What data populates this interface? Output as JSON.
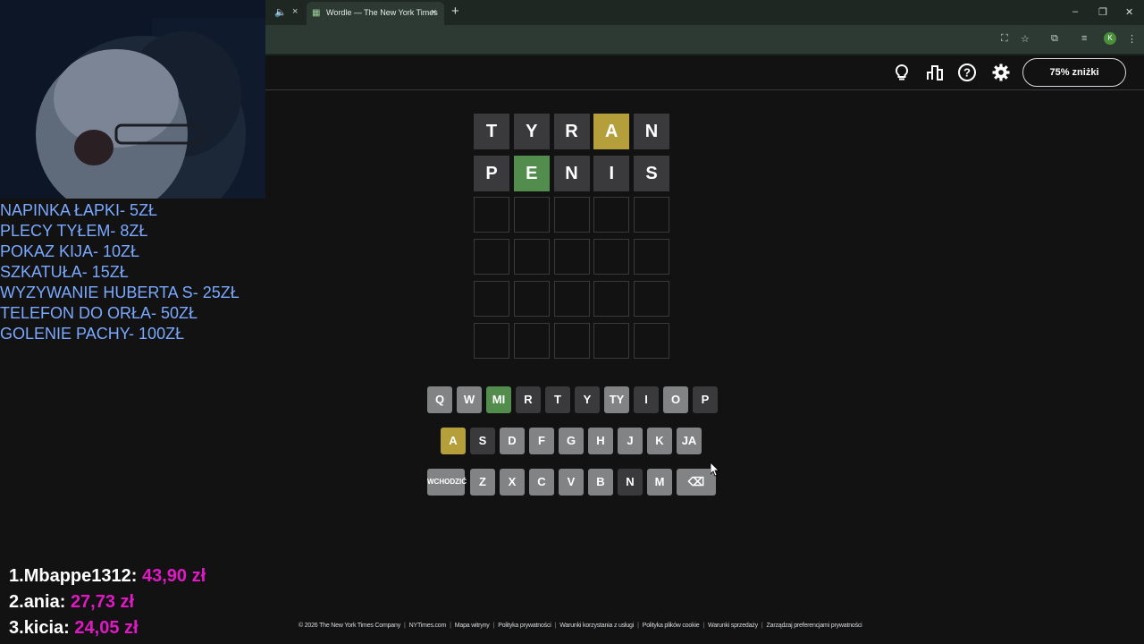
{
  "browser": {
    "prev_tab_close": "×",
    "active_tab_title": "Wordle — The New York Times",
    "tab_close": "×",
    "new_tab": "+",
    "profile_initial": "K",
    "win_minimize": "–",
    "win_restore": "❐",
    "win_close": "✕"
  },
  "header": {
    "subscribe_label": "75% zniżki"
  },
  "board": {
    "rows": [
      [
        {
          "letter": "T",
          "state": "absent"
        },
        {
          "letter": "Y",
          "state": "absent"
        },
        {
          "letter": "R",
          "state": "absent"
        },
        {
          "letter": "A",
          "state": "present"
        },
        {
          "letter": "N",
          "state": "absent"
        }
      ],
      [
        {
          "letter": "P",
          "state": "absent"
        },
        {
          "letter": "E",
          "state": "correct"
        },
        {
          "letter": "N",
          "state": "absent"
        },
        {
          "letter": "I",
          "state": "absent"
        },
        {
          "letter": "S",
          "state": "absent"
        }
      ],
      [
        {
          "letter": "",
          "state": "empty"
        },
        {
          "letter": "",
          "state": "empty"
        },
        {
          "letter": "",
          "state": "empty"
        },
        {
          "letter": "",
          "state": "empty"
        },
        {
          "letter": "",
          "state": "empty"
        }
      ],
      [
        {
          "letter": "",
          "state": "empty"
        },
        {
          "letter": "",
          "state": "empty"
        },
        {
          "letter": "",
          "state": "empty"
        },
        {
          "letter": "",
          "state": "empty"
        },
        {
          "letter": "",
          "state": "empty"
        }
      ],
      [
        {
          "letter": "",
          "state": "empty"
        },
        {
          "letter": "",
          "state": "empty"
        },
        {
          "letter": "",
          "state": "empty"
        },
        {
          "letter": "",
          "state": "empty"
        },
        {
          "letter": "",
          "state": "empty"
        }
      ],
      [
        {
          "letter": "",
          "state": "empty"
        },
        {
          "letter": "",
          "state": "empty"
        },
        {
          "letter": "",
          "state": "empty"
        },
        {
          "letter": "",
          "state": "empty"
        },
        {
          "letter": "",
          "state": "empty"
        }
      ]
    ]
  },
  "keyboard": {
    "rows": [
      [
        {
          "label": "Q",
          "state": "unused"
        },
        {
          "label": "W",
          "state": "unused"
        },
        {
          "label": "MI",
          "state": "correct"
        },
        {
          "label": "R",
          "state": "absent"
        },
        {
          "label": "T",
          "state": "absent"
        },
        {
          "label": "Y",
          "state": "absent"
        },
        {
          "label": "TY",
          "state": "unused"
        },
        {
          "label": "I",
          "state": "absent"
        },
        {
          "label": "O",
          "state": "unused"
        },
        {
          "label": "P",
          "state": "absent"
        }
      ],
      [
        {
          "label": "A",
          "state": "present"
        },
        {
          "label": "S",
          "state": "absent"
        },
        {
          "label": "D",
          "state": "unused"
        },
        {
          "label": "F",
          "state": "unused"
        },
        {
          "label": "G",
          "state": "unused"
        },
        {
          "label": "H",
          "state": "unused"
        },
        {
          "label": "J",
          "state": "unused"
        },
        {
          "label": "K",
          "state": "unused"
        },
        {
          "label": "JA",
          "state": "unused"
        }
      ],
      [
        {
          "label": "WCHODZIĆ",
          "state": "unused",
          "kind": "enter"
        },
        {
          "label": "Z",
          "state": "unused"
        },
        {
          "label": "X",
          "state": "unused"
        },
        {
          "label": "C",
          "state": "unused"
        },
        {
          "label": "V",
          "state": "unused"
        },
        {
          "label": "B",
          "state": "unused"
        },
        {
          "label": "N",
          "state": "absent"
        },
        {
          "label": "M",
          "state": "unused"
        },
        {
          "label": "⌫",
          "state": "unused",
          "kind": "backspace"
        }
      ]
    ]
  },
  "overlay": {
    "donations": [
      "NAPINKA ŁAPKI- 5ZŁ",
      "PLECY TYŁEM- 8ZŁ",
      "POKAZ KIJA- 10ZŁ",
      "SZKATUŁA- 15ZŁ",
      "WYZYWANIE HUBERTA S- 25ZŁ",
      "TELEFON DO ORŁA- 50ZŁ",
      "GOLENIE PACHY- 100ZŁ"
    ],
    "leaderboard": [
      {
        "rank": "1.",
        "name": "Mbappe1312:",
        "amount": "43,90 zł"
      },
      {
        "rank": "2.",
        "name": "ania:",
        "amount": "27,73 zł"
      },
      {
        "rank": "3.",
        "name": "kicia:",
        "amount": "24,05 zł"
      }
    ]
  },
  "footer": {
    "links": [
      "© 2026 The New York Times Company",
      "NYTimes.com",
      "Mapa witryny",
      "Polityka prywatności",
      "Warunki korzystania z usługi",
      "Polityka plików cookie",
      "Warunki sprzedaży",
      "Zarządzaj preferencjami prywatności"
    ]
  },
  "colors": {
    "correct": "#538d4e",
    "present": "#b59f3b",
    "absent": "#3a3a3c",
    "unused": "#818384",
    "donation_text": "#7aa9ff",
    "leader_amount": "#e019c4"
  }
}
